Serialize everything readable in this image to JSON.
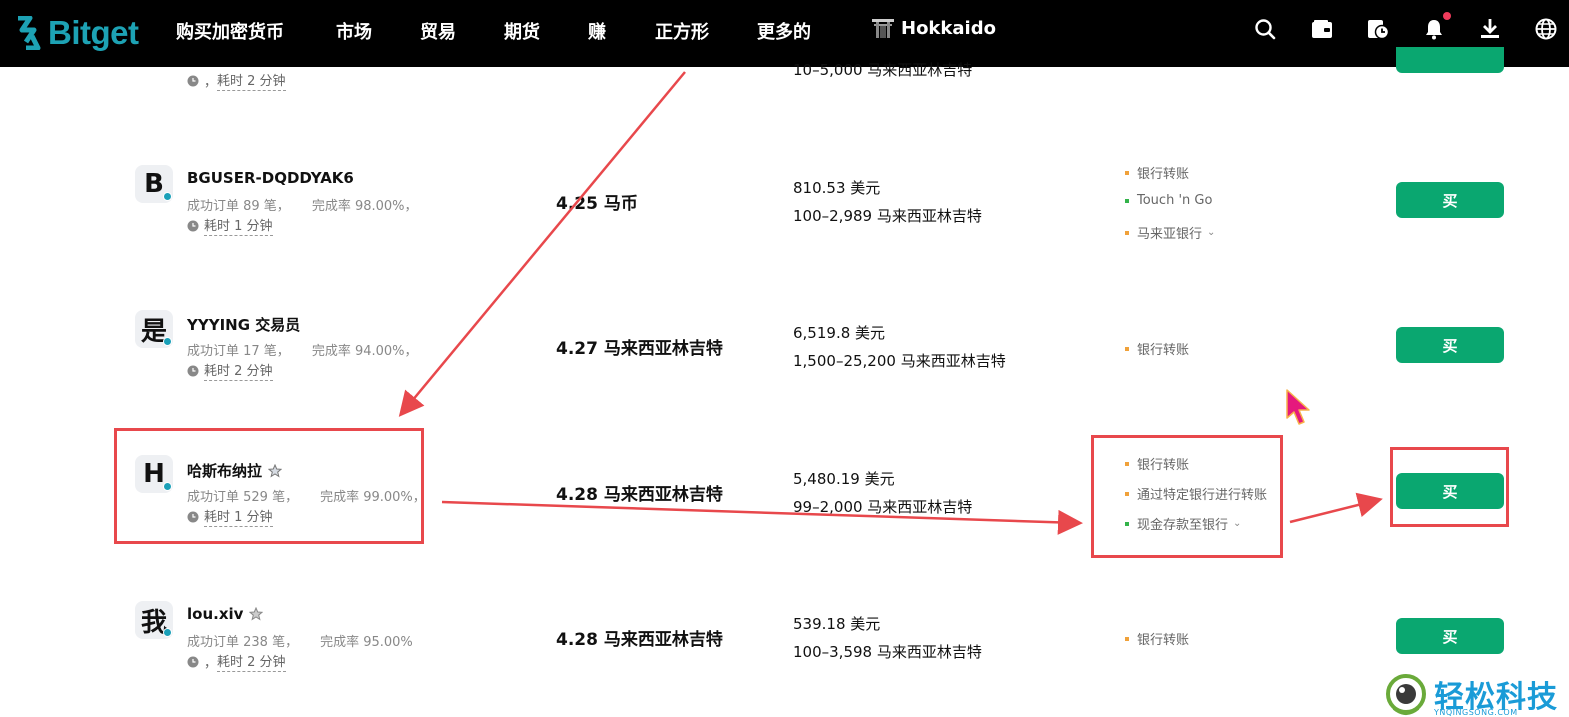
{
  "navbar": {
    "logo_text": "Bitget",
    "items": [
      "购买加密货币",
      "市场",
      "贸易",
      "期货",
      "赚",
      "正方形",
      "更多的"
    ],
    "username": "Hokkaido",
    "icons": [
      "search-icon",
      "wallet-icon",
      "order-history-icon",
      "bell-icon",
      "download-icon",
      "globe-icon"
    ],
    "accent_color": "#1da2b4"
  },
  "top_partial": {
    "time": "耗时 2 分钟",
    "limit": "10–5,000 马来西亚林吉特"
  },
  "rows": [
    {
      "avatar": "B",
      "name": "BGUSER-DQDDYAK6",
      "orders": "成功订单 89 笔，",
      "completion": "完成率 98.00%，",
      "time": "耗时 1 分钟",
      "price": "4.25 马币",
      "available": "810.53 美元",
      "limit": "100–2,989 马来西亚林吉特",
      "payments": [
        {
          "label": "银行转账",
          "color": "orange",
          "chevron": false
        },
        {
          "label": "Touch 'n Go",
          "color": "green",
          "chevron": false
        },
        {
          "label": "马来亚银行",
          "color": "orange",
          "chevron": true
        }
      ],
      "action": "买"
    },
    {
      "avatar": "是",
      "name": "YYYING 交易员",
      "orders": "成功订单 17 笔，",
      "completion": "完成率 94.00%，",
      "time": "耗时 2 分钟",
      "price": "4.27 马来西亚林吉特",
      "available": "6,519.8 美元",
      "limit": "1,500–25,200 马来西亚林吉特",
      "payments": [
        {
          "label": "银行转账",
          "color": "orange",
          "chevron": false
        }
      ],
      "action": "买"
    },
    {
      "avatar": "H",
      "name": "哈斯布纳拉",
      "orders": "成功订单 529 笔，",
      "completion": "完成率 99.00%，",
      "time": "耗时 1 分钟",
      "price": "4.28 马来西亚林吉特",
      "available": "5,480.19 美元",
      "limit": "99–2,000 马来西亚林吉特",
      "payments": [
        {
          "label": "银行转账",
          "color": "orange",
          "chevron": false
        },
        {
          "label": "通过特定银行进行转账",
          "color": "orange",
          "chevron": false
        },
        {
          "label": "现金存款至银行",
          "color": "green",
          "chevron": true
        }
      ],
      "action": "买"
    },
    {
      "avatar": "我",
      "name": "lou.xiv",
      "orders": "成功订单 238 笔，",
      "completion": "完成率 95.00%",
      "time": "耗时 2 分钟",
      "price": "4.28 马来西亚林吉特",
      "available": "539.18 美元",
      "limit": "100–3,598 马来西亚林吉特",
      "payments": [
        {
          "label": "银行转账",
          "color": "orange",
          "chevron": false
        }
      ],
      "action": "买"
    }
  ],
  "watermark": {
    "text": "轻松科技",
    "sub": "YNQINGSONG.COM"
  },
  "colors": {
    "buy_button": "#0aa770",
    "annotation_red": "#e8484c",
    "cursor": "#e5197d"
  }
}
